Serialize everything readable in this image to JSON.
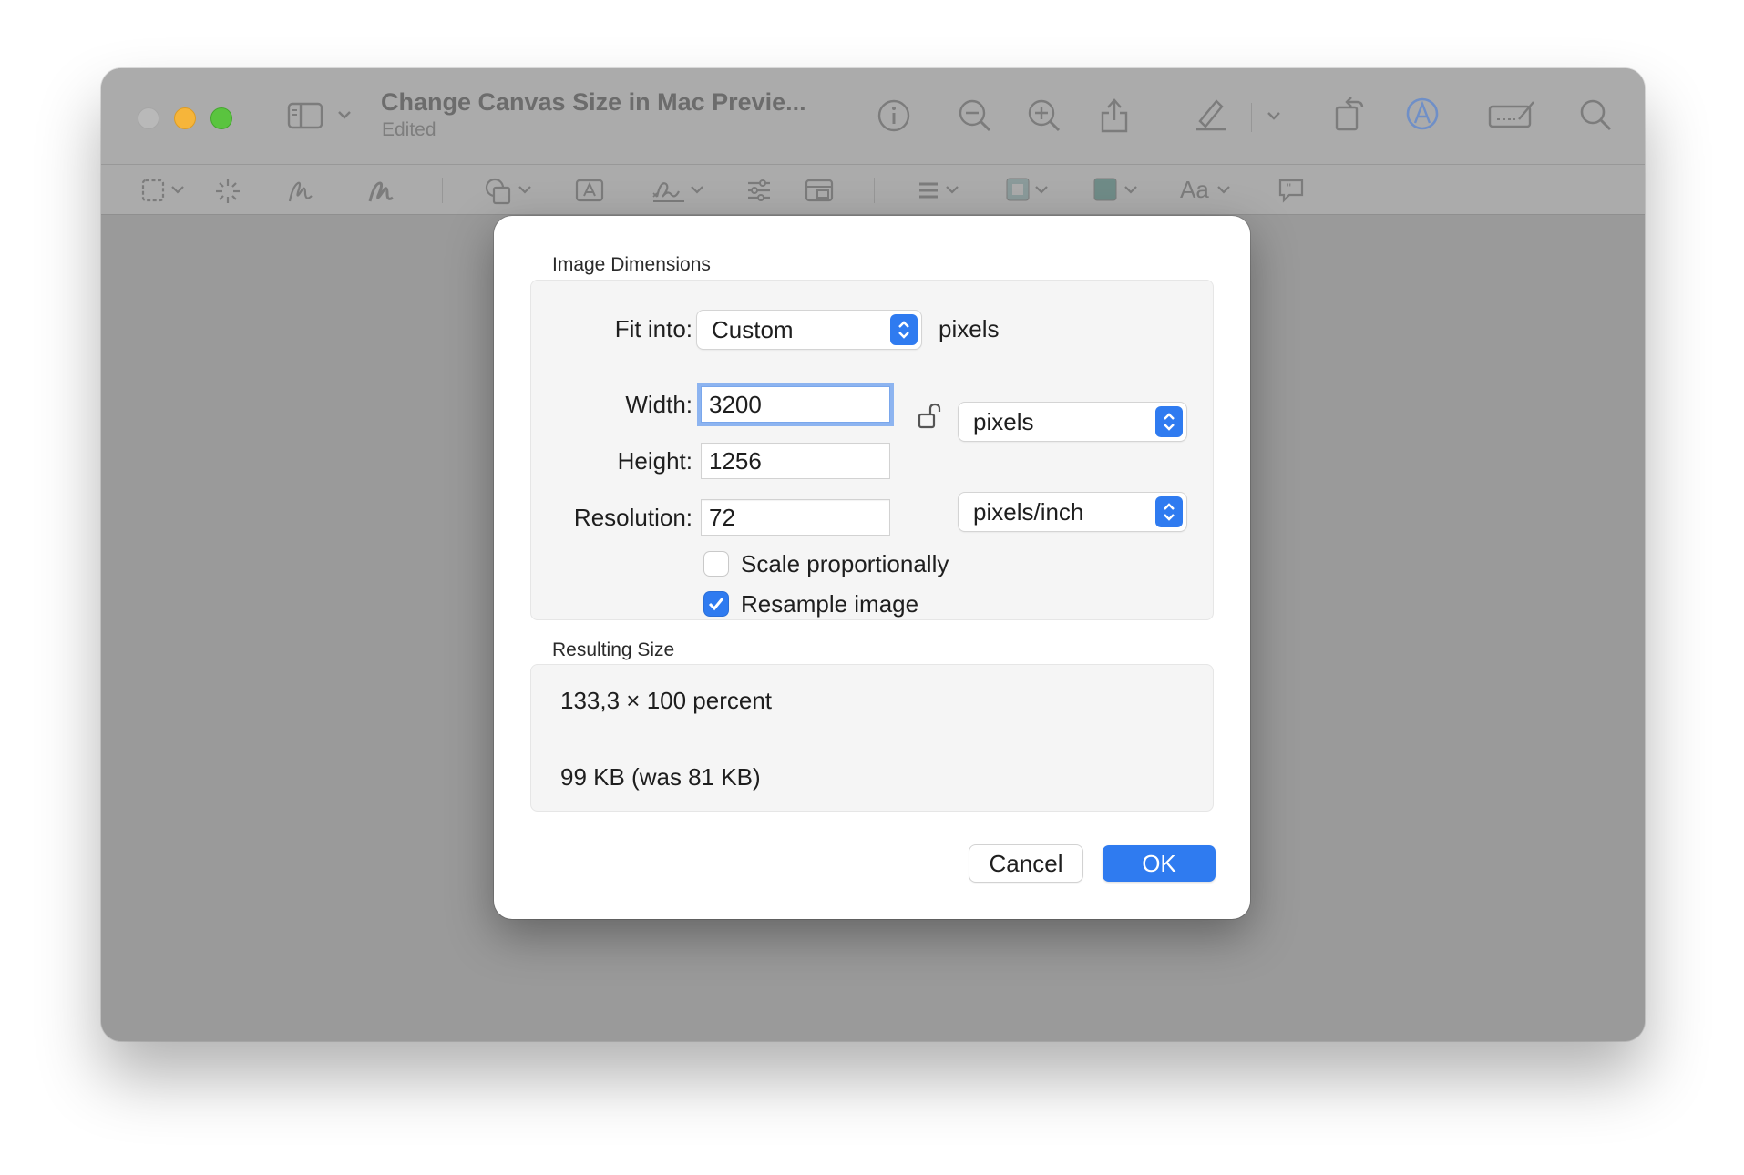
{
  "window": {
    "title": "Change Canvas Size in Mac Previe...",
    "subtitle": "Edited"
  },
  "titlebar_icons": [
    "sidebar-icon",
    "chevron-down-icon",
    "info-icon",
    "zoom-out-icon",
    "zoom-in-icon",
    "share-icon",
    "pencil-icon",
    "chevron-down-icon",
    "rotate-icon",
    "markup-icon",
    "signature-icon",
    "search-icon"
  ],
  "markup_toolbar": {
    "text_style_label": "Aa",
    "icons": [
      "rectangular-selection-icon",
      "instant-alpha-icon",
      "sketch-icon",
      "draw-icon",
      "shapes-icon",
      "text-box-icon",
      "sign-icon",
      "adjust-color-icon",
      "adjust-size-icon",
      "shape-style-icon",
      "border-color-icon",
      "fill-color-icon",
      "text-style-icon",
      "note-icon"
    ],
    "border_color": "#8a9a9a",
    "fill_color": "#6f8b87"
  },
  "dialog": {
    "image_dimensions_title": "Image Dimensions",
    "fit_into_label": "Fit into:",
    "fit_into_value": "Custom",
    "fit_into_unit": "pixels",
    "width_label": "Width:",
    "width_value": "3200",
    "height_label": "Height:",
    "height_value": "1256",
    "resolution_label": "Resolution:",
    "resolution_value": "72",
    "size_unit_value": "pixels",
    "resolution_unit_value": "pixels/inch",
    "scale_proportionally_label": "Scale proportionally",
    "scale_proportionally_checked": false,
    "resample_image_label": "Resample image",
    "resample_image_checked": true,
    "resulting_size_title": "Resulting Size",
    "resulting_percent": "133,3 × 100 percent",
    "resulting_file_size": "99 KB (was 81 KB)",
    "cancel_label": "Cancel",
    "ok_label": "OK"
  },
  "colors": {
    "accent": "#2f7bf0",
    "close_light": "#b9b9b9",
    "minimize_light": "#f6b53a",
    "maximize_light": "#5ac43f"
  }
}
